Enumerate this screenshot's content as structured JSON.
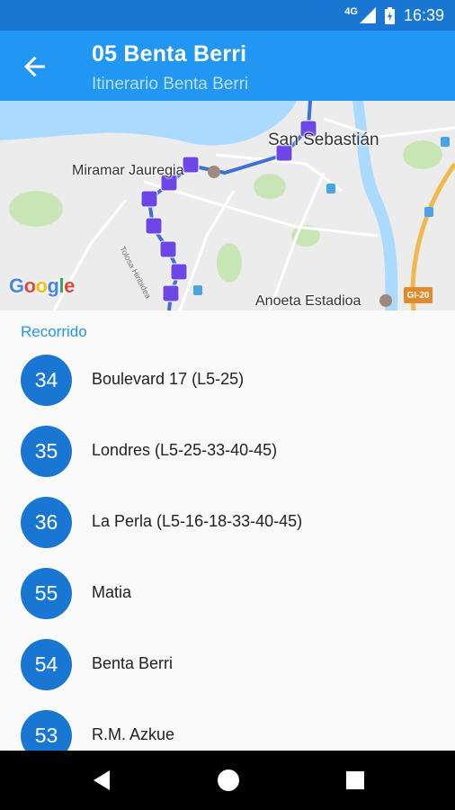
{
  "status_bar": {
    "network": "4G",
    "time": "16:39"
  },
  "app_bar": {
    "title": "05 Benta Berri",
    "subtitle": "Itinerario Benta Berri"
  },
  "map": {
    "labels": {
      "city": "San Sebastián",
      "miramar": "Miramar Jauregia",
      "stadium": "Anoeta Estadioa",
      "street": "Tolosa Hiribidea",
      "road_sign": "GI-20",
      "attribution": "Google"
    },
    "colors": {
      "water": "#aadaff",
      "land": "#ececec",
      "park": "#c8e6b5",
      "route": "#3f6fd8",
      "bus_marker": "#6c46e6"
    }
  },
  "route_list": {
    "header": "Recorrido",
    "stops": [
      {
        "number": "34",
        "name": "Boulevard 17 (L5-25)"
      },
      {
        "number": "35",
        "name": "Londres (L5-25-33-40-45)"
      },
      {
        "number": "36",
        "name": "La Perla (L5-16-18-33-40-45)"
      },
      {
        "number": "55",
        "name": "Matia"
      },
      {
        "number": "54",
        "name": "Benta Berri"
      },
      {
        "number": "53",
        "name": "R.M. Azkue"
      }
    ]
  },
  "nav_bar": {
    "back_icon": "triangle-back-icon",
    "home_icon": "circle-home-icon",
    "recents_icon": "square-recents-icon"
  }
}
